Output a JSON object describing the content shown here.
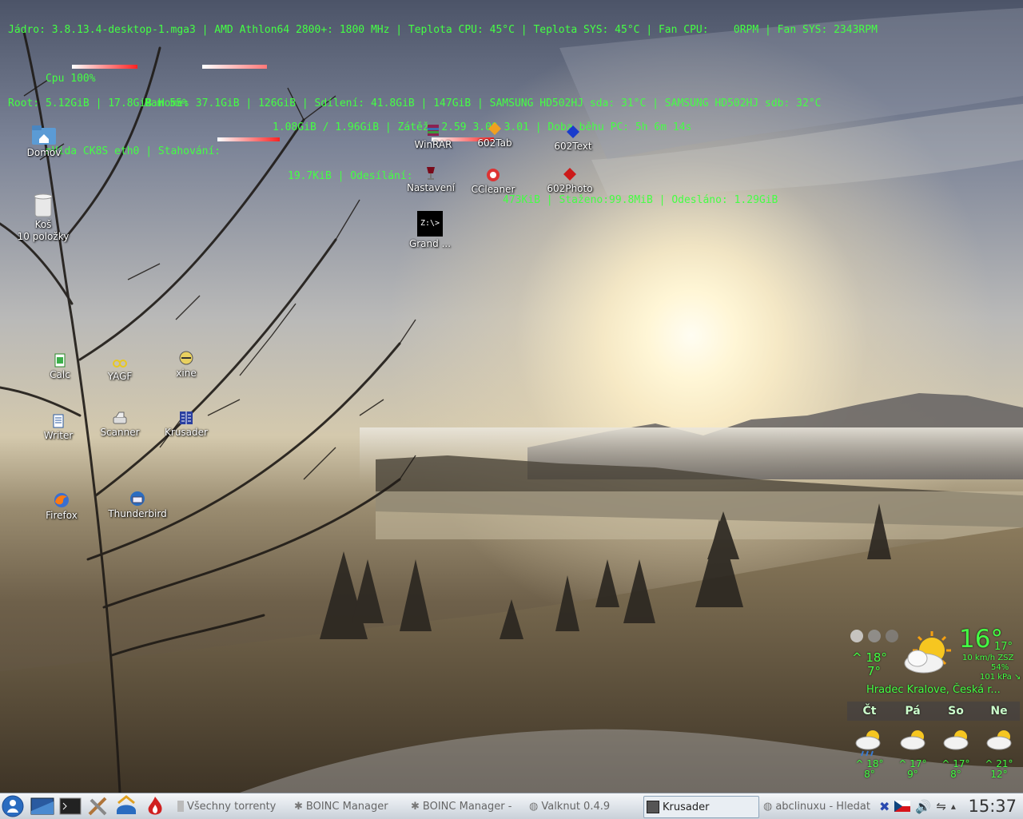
{
  "conky": {
    "line1": "Jádro: 3.8.13.4-desktop-1.mga3 | AMD Athlon64 2800+: 1800 MHz | Teplota CPU: 45°C | Teplota SYS: 45°C | Fan CPU:    0RPM | Fan SYS: 2343RPM",
    "cpu_label": "Cpu 100%",
    "ram_label": "Ram 55%",
    "ram_text": "1.08GiB / 1.96GiB | Zátěž: 2.59 3.00 3.01 | Doba běhu PC: 5h 6m 14s",
    "line3": "Root: 5.12GiB | 17.8GiB Home: 37.1GiB | 126GiB | Sdílení: 41.8GiB | 147GiB | SAMSUNG HD502HJ sda: 31°C | SAMSUNG HD502HJ sdb: 32°C",
    "net_label": "nVida CK8S eth0 | Stahování:",
    "down_speed": "19.7KiB | Odesílání:",
    "up_text": "473KiB | Staženo:99.8MiB | Odesláno: 1.29GiB",
    "cpu_usage": 1.0,
    "ram_usage": 0.55
  },
  "desktop_icons": [
    {
      "label": "Domov",
      "icon": "home-folder-icon"
    },
    {
      "label": "Koš",
      "sub": "10 položky",
      "icon": "trash-icon"
    },
    {
      "label": "WinRAR",
      "icon": "winrar-icon"
    },
    {
      "label": "602Tab",
      "icon": "602tab-icon"
    },
    {
      "label": "602Text",
      "icon": "602text-icon"
    },
    {
      "label": "Nastavení",
      "icon": "wine-glass-icon"
    },
    {
      "label": "CCleaner",
      "icon": "ccleaner-icon"
    },
    {
      "label": "602Photo",
      "icon": "602photo-icon"
    },
    {
      "label": "Grand ...",
      "icon": "terminal-icon",
      "glyph_text": "Z:\\>"
    },
    {
      "label": "Calc",
      "icon": "calc-icon"
    },
    {
      "label": "YAGF",
      "icon": "yagf-icon"
    },
    {
      "label": "xine",
      "icon": "xine-icon"
    },
    {
      "label": "Writer",
      "icon": "writer-icon"
    },
    {
      "label": "Scanner",
      "icon": "scanner-icon"
    },
    {
      "label": "Krusader",
      "icon": "krusader-icon"
    },
    {
      "label": "Firefox",
      "icon": "firefox-icon"
    },
    {
      "label": "Thunderbird",
      "icon": "thunderbird-icon"
    }
  ],
  "weather": {
    "current_temp": "16°",
    "feels_like": "17°",
    "wind": "10 km/h ZSZ",
    "humidity": "54%",
    "pressure": "101 kPa ↘",
    "today_high": "^ 18°",
    "today_low": "7°",
    "location": "Hradec Kralove, Česká r...",
    "days": [
      "Čt",
      "Pá",
      "So",
      "Ne"
    ],
    "forecast": [
      {
        "high": "^ 18°",
        "low": "8°"
      },
      {
        "high": "^ 17°",
        "low": "9°"
      },
      {
        "high": "^ 17°",
        "low": "8°"
      },
      {
        "high": "^ 21°",
        "low": "12°"
      }
    ]
  },
  "taskbar": {
    "tasks": [
      {
        "label": "Všechny torrenty"
      },
      {
        "label": "BOINC Manager"
      },
      {
        "label": "BOINC Manager - "
      },
      {
        "label": "Valknut 0.4.9"
      },
      {
        "label": "Krusader"
      },
      {
        "label": "abclinuxu - Hledat"
      }
    ],
    "clock": "15:37"
  },
  "colors": {
    "conky_text": "#44ff44",
    "taskbar_bg": "#dfe4ea"
  }
}
